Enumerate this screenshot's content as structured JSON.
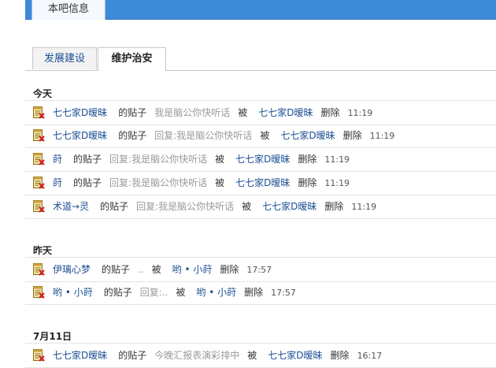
{
  "header": {
    "tab_label": "本吧信息"
  },
  "tabs": [
    {
      "label": "发展建设"
    },
    {
      "label": "维护治安"
    }
  ],
  "sections": [
    {
      "title": "今天",
      "rows": [
        {
          "poster": "七七家D暧昧",
          "of_post": "的贴子",
          "quote": "我是脑公你快听话",
          "by": "被",
          "actor": "七七家D暧昧",
          "action": "删除",
          "time": "11:19"
        },
        {
          "poster": "七七家D暧昧",
          "of_post": "的贴子",
          "quote": "回复:我是脑公你快听话",
          "by": "被",
          "actor": "七七家D暧昧",
          "action": "删除",
          "time": "11:19"
        },
        {
          "poster": "莳",
          "of_post": "的贴子",
          "quote": "回复:我是脑公你快听话",
          "by": "被",
          "actor": "七七家D暧昧",
          "action": "删除",
          "time": "11:19"
        },
        {
          "poster": "莳",
          "of_post": "的贴子",
          "quote": "回复:我是脑公你快听话",
          "by": "被",
          "actor": "七七家D暧昧",
          "action": "删除",
          "time": "11:19"
        },
        {
          "poster": "术道→灵",
          "of_post": "的贴子",
          "quote": "回复:我是脑公你快听话",
          "by": "被",
          "actor": "七七家D暧昧",
          "action": "删除",
          "time": "11:19"
        }
      ]
    },
    {
      "title": "昨天",
      "rows": [
        {
          "poster": "伊璃心梦",
          "of_post": "的贴子",
          "quote": "..",
          "by": "被",
          "actor": "哟 • 小莳",
          "action": "删除",
          "time": "17:57"
        },
        {
          "poster": "哟 • 小莳",
          "of_post": "的贴子",
          "quote": "回复:..",
          "by": "被",
          "actor": "哟 • 小莳",
          "action": "删除",
          "time": "17:57"
        }
      ]
    },
    {
      "title": "7月11日",
      "rows": [
        {
          "poster": "七七家D暧昧",
          "of_post": "的贴子",
          "quote": "今晚汇报表演彩排中",
          "by": "被",
          "actor": "七七家D暧昧",
          "action": "删除",
          "time": "16:17"
        }
      ]
    }
  ]
}
